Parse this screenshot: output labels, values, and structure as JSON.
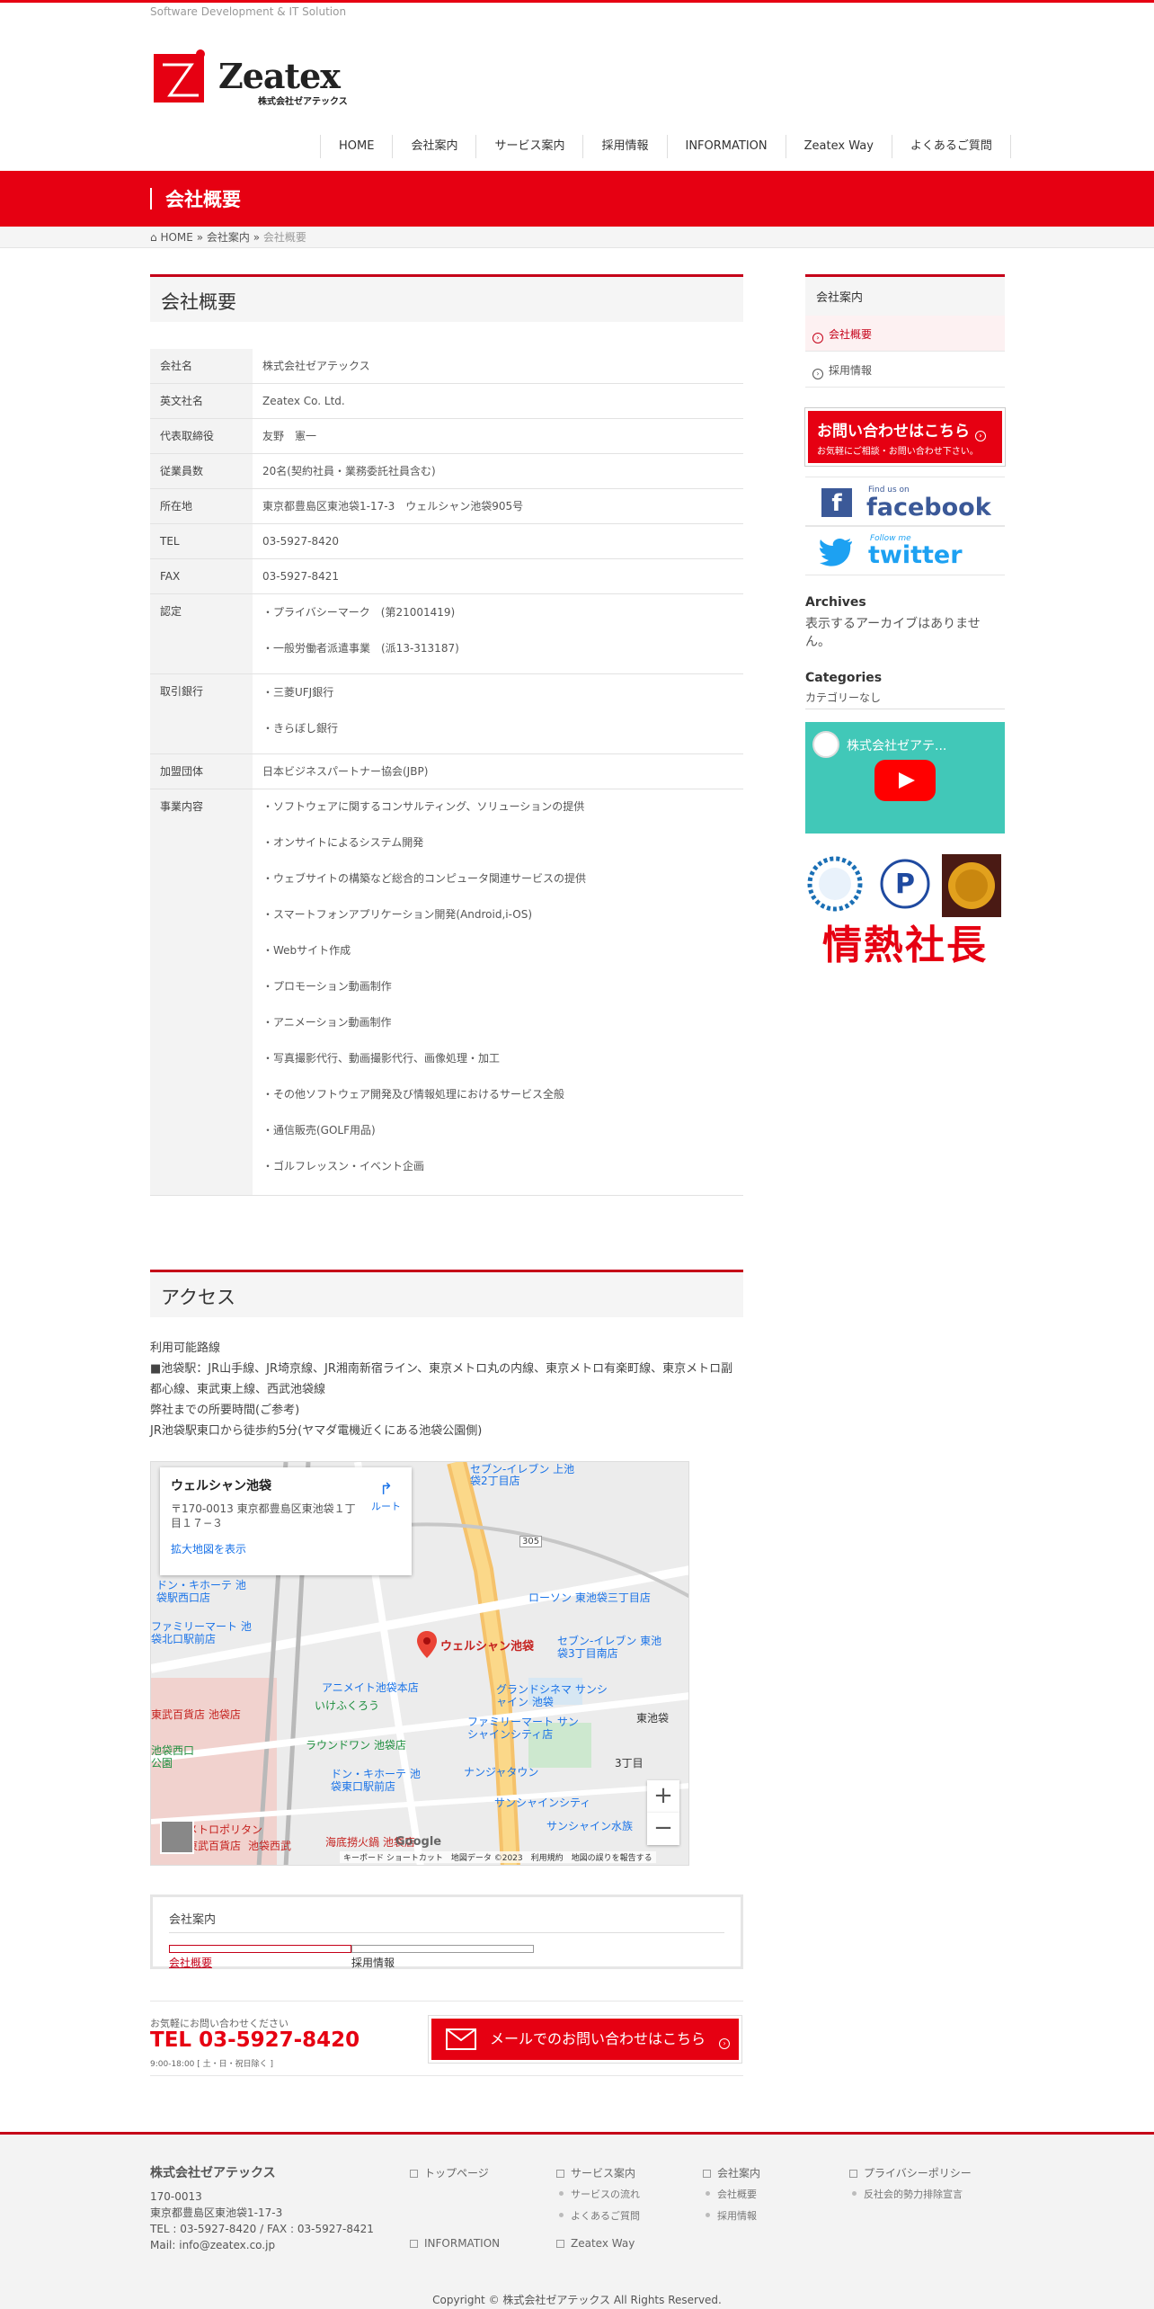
{
  "header": {
    "tagline": "Software Development & IT Solution",
    "logo_text": "Zeatex",
    "logo_sub": "株式会社ゼアテックス",
    "nav": [
      "HOME",
      "会社案内",
      "サービス案内",
      "採用情報",
      "INFORMATION",
      "Zeatex Way",
      "よくあるご質問"
    ]
  },
  "page_title": "会社概要",
  "breadcrumb": {
    "home": "HOME",
    "sep": "»",
    "parent": "会社案内",
    "current": "会社概要"
  },
  "profile": {
    "heading": "会社概要",
    "rows": [
      {
        "key": "会社名",
        "values": [
          "株式会社ゼアテックス"
        ]
      },
      {
        "key": "英文社名",
        "values": [
          "Zeatex Co. Ltd."
        ]
      },
      {
        "key": "代表取締役",
        "values": [
          "友野　憲一"
        ]
      },
      {
        "key": "従業員数",
        "values": [
          "20名(契約社員・業務委託社員含む)"
        ]
      },
      {
        "key": "所在地",
        "values": [
          "東京都豊島区東池袋1-17-3　ウェルシャン池袋905号"
        ]
      },
      {
        "key": "TEL",
        "values": [
          "03-5927-8420"
        ]
      },
      {
        "key": "FAX",
        "values": [
          "03-5927-8421"
        ]
      },
      {
        "key": "認定",
        "values": [
          "・プライバシーマーク　(第21001419)",
          "・一般労働者派遣事業　(派13-313187)"
        ]
      },
      {
        "key": "取引銀行",
        "values": [
          "・三菱UFJ銀行",
          "・きらぼし銀行"
        ]
      },
      {
        "key": "加盟団体",
        "values": [
          "日本ビジネスパートナー協会(JBP)"
        ]
      },
      {
        "key": "事業内容",
        "values": [
          "・ソフトウェアに関するコンサルティング、ソリューションの提供",
          "・オンサイトによるシステム開発",
          "・ウェブサイトの構築など総合的コンピュータ関連サービスの提供",
          "・スマートフォンアプリケーション開発(Android,i-OS)",
          "・Webサイト作成",
          "・プロモーション動画制作",
          "・アニメーション動画制作",
          "・写真撮影代行、動画撮影代行、画像処理・加工",
          "・その他ソフトウェア開発及び情報処理におけるサービス全般",
          "・通信販売(GOLF用品)",
          "・ゴルフレッスン・イベント企画"
        ]
      }
    ]
  },
  "access": {
    "heading": "アクセス",
    "lines": [
      "利用可能路線",
      "■池袋駅：JR山手線、JR埼京線、JR湘南新宿ライン、東京メトロ丸の内線、東京メトロ有楽町線、東京メトロ副都心線、東武東上線、西武池袋線",
      "弊社までの所要時間(ご参考)",
      "JR池袋駅東口から徒歩約5分(ヤマダ電機近くにある池袋公園側)"
    ]
  },
  "map": {
    "place": "ウェルシャン池袋",
    "address": "〒170-0013 東京都豊島区東池袋１丁目１７−３",
    "larger_map": "拡大地図を表示",
    "route": "ルート",
    "pin_label": "ウェルシャン池袋",
    "labels": [
      "セブン-イレブン 上池袋2丁目店",
      "ドン・キホーテ 池袋駅西口店",
      "ファミリーマート 池袋北口駅前店",
      "ローソン 東池袋三丁目店",
      "セブン-イレブン 東池袋3丁目南店",
      "アニメイト池袋本店",
      "いけふくろう",
      "東武百貨店 池袋店",
      "グランドシネマ サンシャイン 池袋",
      "ファミリーマート サンシャインシティ店",
      "東池袋",
      "ラウンドワン 池袋店",
      "ドン・キホーテ 池袋東口駅前店",
      "ナンジャタウン",
      "3丁目",
      "サンシャインシティ",
      "サンシャイン水族",
      "池袋西口公園",
      "メトロポリタン",
      "東武百貨店",
      "池袋西武",
      "海底撈火鍋 池袋店",
      "305"
    ],
    "footer": "キーボード ショートカット　地図データ ©2023　利用規約　地図の誤りを報告する",
    "google": "Google",
    "zoom_in": "+",
    "zoom_out": "−"
  },
  "subnav": {
    "title": "会社案内",
    "items": [
      "会社概要",
      "採用情報"
    ]
  },
  "cta": {
    "small": "お気軽にお問い合わせください",
    "tel": "TEL 03-5927-8420",
    "hours": "9:00-18:00 [ 土・日・祝日除く ]",
    "button": "メールでのお問い合わせはこちら"
  },
  "sidebar": {
    "heading": "会社案内",
    "items": [
      "会社概要",
      "採用情報"
    ],
    "contact_banner": {
      "line1": "お問い合わせはこちら",
      "line2": "お気軽にご相談・お問い合わせ下さい。"
    },
    "facebook": {
      "small": "Find us on",
      "big": "facebook"
    },
    "twitter": {
      "small": "Follow me",
      "big": "twitter"
    },
    "archives_title": "Archives",
    "archives_text": "表示するアーカイブはありません。",
    "categories_title": "Categories",
    "categories_text": "カテゴリーなし",
    "video_title": "株式会社ゼアテ...",
    "banner_passion": "情熱社長"
  },
  "footer": {
    "company": "株式会社ゼアテックス",
    "info": [
      "170-0013",
      "東京都豊島区東池袋1-17-3",
      "TEL : 03-5927-8420 / FAX : 03-5927-8421",
      "Mail: info@zeatex.co.jp"
    ],
    "col1": [
      "トップページ",
      "INFORMATION"
    ],
    "col2": [
      "サービス案内",
      "サービスの流れ",
      "よくあるご質問",
      "Zeatex Way"
    ],
    "col3": [
      "会社案内",
      "会社概要",
      "採用情報"
    ],
    "col4": [
      "プライバシーポリシー",
      "反社会的勢力排除宣言"
    ],
    "copyright": "Copyright © 株式会社ゼアテックス All Rights Reserved."
  },
  "colors": {
    "brand_red": "#e60012",
    "dark_red": "#c50018"
  }
}
